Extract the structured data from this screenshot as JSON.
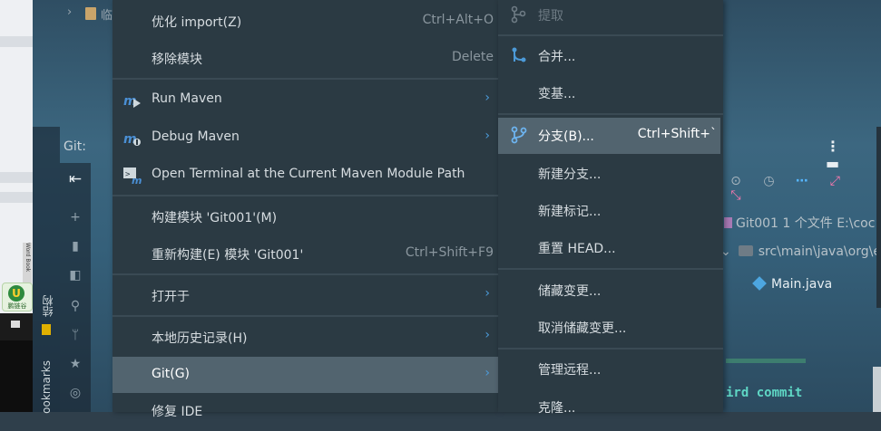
{
  "background": {
    "top_label": "临",
    "git_panel_label": "Git:",
    "vertical_tab_structure": "结构",
    "vertical_tab_bookmarks": "ookmarks",
    "commit_info": "Git001  1 个文件  E:\\coc",
    "tree_path": "src\\main\\java\\org\\e",
    "tree_file": "Main.java",
    "commit_message": "ird commit",
    "logo_text": "鹏链谷"
  },
  "context_menu": {
    "items": [
      {
        "label": "优化 import(Z)",
        "shortcut": "Ctrl+Alt+O",
        "icon": "",
        "submenu": false
      },
      {
        "label": "移除模块",
        "shortcut": "Delete",
        "icon": "",
        "submenu": false
      },
      {
        "label": "Run Maven",
        "shortcut": "",
        "icon": "maven-run-icon",
        "submenu": true
      },
      {
        "label": "Debug Maven",
        "shortcut": "",
        "icon": "maven-debug-icon",
        "submenu": true
      },
      {
        "label": "Open Terminal at the Current Maven Module Path",
        "shortcut": "",
        "icon": "maven-terminal-icon",
        "submenu": false
      },
      {
        "label": "构建模块 'Git001'(M)",
        "shortcut": "",
        "icon": "",
        "submenu": false
      },
      {
        "label": "重新构建(E) 模块 'Git001'",
        "shortcut": "Ctrl+Shift+F9",
        "icon": "",
        "submenu": false
      },
      {
        "label": "打开于",
        "shortcut": "",
        "icon": "",
        "submenu": true
      },
      {
        "label": "本地历史记录(H)",
        "shortcut": "",
        "icon": "",
        "submenu": true
      },
      {
        "label": "Git(G)",
        "shortcut": "",
        "icon": "",
        "submenu": true,
        "highlighted": true
      },
      {
        "label": "修复 IDE",
        "shortcut": "",
        "icon": "",
        "submenu": false
      }
    ]
  },
  "git_submenu": {
    "items": [
      {
        "label": "提取",
        "shortcut": "",
        "icon": "git-fetch-icon",
        "disabled": true
      },
      {
        "label": "合并...",
        "shortcut": "",
        "icon": "git-merge-icon"
      },
      {
        "label": "变基...",
        "shortcut": "",
        "icon": ""
      },
      {
        "label": "分支(B)...",
        "shortcut": "Ctrl+Shift+`",
        "icon": "git-branch-icon",
        "highlighted": true
      },
      {
        "label": "新建分支...",
        "shortcut": "",
        "icon": ""
      },
      {
        "label": "新建标记...",
        "shortcut": "",
        "icon": ""
      },
      {
        "label": "重置 HEAD...",
        "shortcut": "",
        "icon": ""
      },
      {
        "label": "储藏变更...",
        "shortcut": "",
        "icon": ""
      },
      {
        "label": "取消储藏变更...",
        "shortcut": "",
        "icon": ""
      },
      {
        "label": "管理远程...",
        "shortcut": "",
        "icon": ""
      },
      {
        "label": "克隆...",
        "shortcut": "",
        "icon": ""
      }
    ]
  },
  "colors": {
    "menu_bg": "#2b3a43",
    "highlight_bg": "#52646f",
    "accent_blue": "#4c9ad8",
    "maven_blue": "#4a8fd4"
  }
}
